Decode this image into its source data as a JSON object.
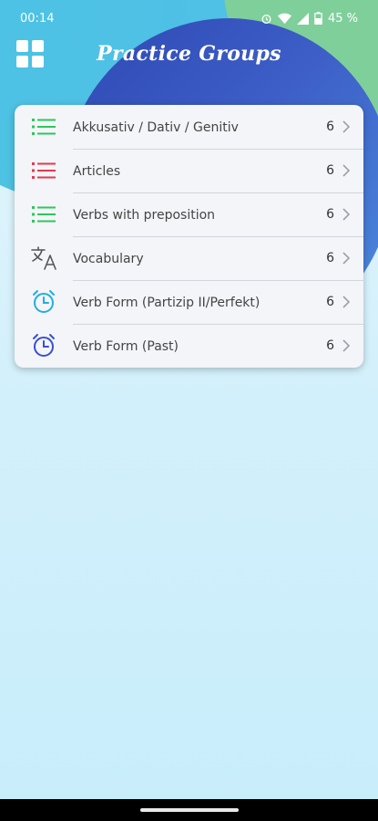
{
  "status": {
    "time": "00:14",
    "battery": "45 %",
    "icons": [
      "alarm-icon",
      "wifi-icon",
      "signal-icon",
      "battery-icon"
    ]
  },
  "header": {
    "title": "Practice Groups",
    "menu_icon": "grid-icon"
  },
  "groups": [
    {
      "label": "Akkusativ / Dativ / Genitiv",
      "count": "6",
      "icon": "list-icon",
      "color": "#2ec75a"
    },
    {
      "label": "Articles",
      "count": "6",
      "icon": "list-icon",
      "color": "#e5394d"
    },
    {
      "label": "Verbs with preposition",
      "count": "6",
      "icon": "list-icon",
      "color": "#2ec75a"
    },
    {
      "label": "Vocabulary",
      "count": "6",
      "icon": "translate-icon",
      "color": "#555555"
    },
    {
      "label": "Verb Form (Partizip II/Perfekt)",
      "count": "6",
      "icon": "alarm-clock-icon",
      "color": "#22aee0"
    },
    {
      "label": "Verb Form (Past)",
      "count": "6",
      "icon": "alarm-clock-icon",
      "color": "#3a4fd6"
    }
  ],
  "colors": {
    "blob_blue": "#2f48b3",
    "blob_cyan": "#4cc3e3",
    "blob_green": "#7fcf9b",
    "background": "#d3f0fb"
  }
}
